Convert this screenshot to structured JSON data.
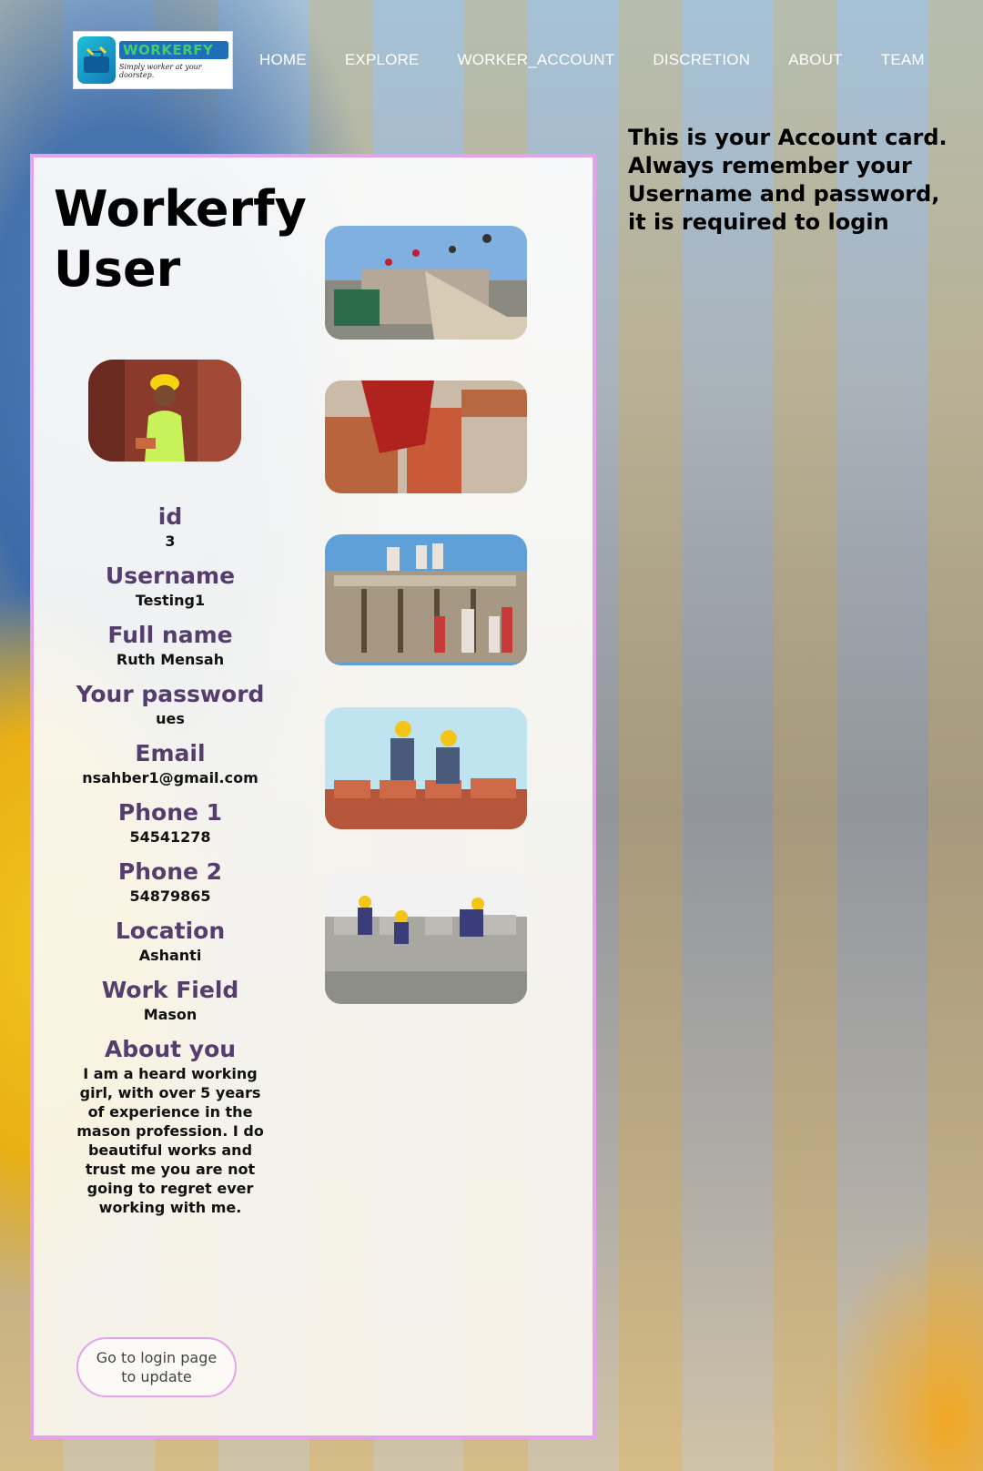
{
  "nav": {
    "logo_word": "WORKERFY",
    "logo_tagline": "Simply worker at your doorstep.",
    "links": [
      "HOME",
      "EXPLORE",
      "WORKER_ACCOUNT",
      "DISCRETION",
      "ABOUT",
      "TEAM"
    ]
  },
  "note": "This is your Account card. Always remember your Username and password, it is required to login",
  "card": {
    "title": "Workerfy User",
    "fields": [
      {
        "label": "id",
        "value": "3"
      },
      {
        "label": "Username",
        "value": "Testing1"
      },
      {
        "label": "Full name",
        "value": "Ruth Mensah"
      },
      {
        "label": "Your password",
        "value": "ues"
      },
      {
        "label": "Email",
        "value": "nsahber1@gmail.com"
      },
      {
        "label": "Phone 1",
        "value": "54541278"
      },
      {
        "label": "Phone 2",
        "value": "54879865"
      },
      {
        "label": "Location",
        "value": "Ashanti"
      },
      {
        "label": "Work Field",
        "value": "Mason"
      },
      {
        "label": "About you",
        "value": "I am a heard working girl, with over 5 years of experience in the mason profession. I do beautiful works and trust me you are not going to regret ever working with me."
      }
    ],
    "button_label": "Go to login page to update"
  },
  "colors": {
    "card_border": "#e5a3ec",
    "label": "#553e6e",
    "nav_text": "#ffffff"
  }
}
